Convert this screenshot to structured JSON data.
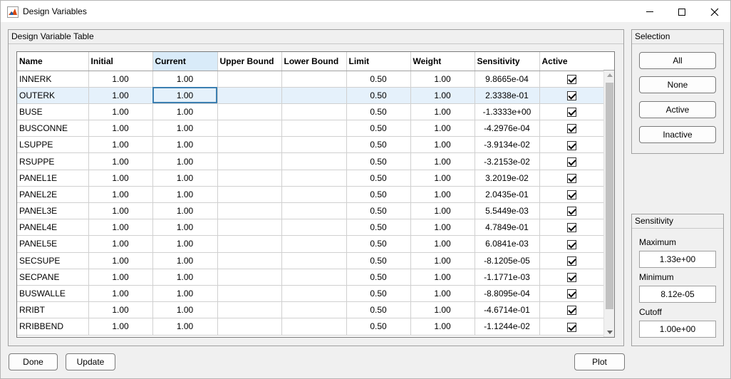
{
  "window": {
    "title": "Design Variables"
  },
  "table_panel": {
    "title": "Design Variable Table"
  },
  "table": {
    "headers": [
      "Name",
      "Initial",
      "Current",
      "Upper Bound",
      "Lower Bound",
      "Limit",
      "Weight",
      "Sensitivity",
      "Active"
    ],
    "rows": [
      {
        "name": "INNERK",
        "initial": "1.00",
        "current": "1.00",
        "upper": "",
        "lower": "",
        "limit": "0.50",
        "weight": "1.00",
        "sensitivity": "9.8665e-04",
        "active": true
      },
      {
        "name": "OUTERK",
        "initial": "1.00",
        "current": "1.00",
        "upper": "",
        "lower": "",
        "limit": "0.50",
        "weight": "1.00",
        "sensitivity": "2.3338e-01",
        "active": true
      },
      {
        "name": "BUSE",
        "initial": "1.00",
        "current": "1.00",
        "upper": "",
        "lower": "",
        "limit": "0.50",
        "weight": "1.00",
        "sensitivity": "-1.3333e+00",
        "active": true
      },
      {
        "name": "BUSCONNE",
        "initial": "1.00",
        "current": "1.00",
        "upper": "",
        "lower": "",
        "limit": "0.50",
        "weight": "1.00",
        "sensitivity": "-4.2976e-04",
        "active": true
      },
      {
        "name": "LSUPPE",
        "initial": "1.00",
        "current": "1.00",
        "upper": "",
        "lower": "",
        "limit": "0.50",
        "weight": "1.00",
        "sensitivity": "-3.9134e-02",
        "active": true
      },
      {
        "name": "RSUPPE",
        "initial": "1.00",
        "current": "1.00",
        "upper": "",
        "lower": "",
        "limit": "0.50",
        "weight": "1.00",
        "sensitivity": "-3.2153e-02",
        "active": true
      },
      {
        "name": "PANEL1E",
        "initial": "1.00",
        "current": "1.00",
        "upper": "",
        "lower": "",
        "limit": "0.50",
        "weight": "1.00",
        "sensitivity": "3.2019e-02",
        "active": true
      },
      {
        "name": "PANEL2E",
        "initial": "1.00",
        "current": "1.00",
        "upper": "",
        "lower": "",
        "limit": "0.50",
        "weight": "1.00",
        "sensitivity": "2.0435e-01",
        "active": true
      },
      {
        "name": "PANEL3E",
        "initial": "1.00",
        "current": "1.00",
        "upper": "",
        "lower": "",
        "limit": "0.50",
        "weight": "1.00",
        "sensitivity": "5.5449e-03",
        "active": true
      },
      {
        "name": "PANEL4E",
        "initial": "1.00",
        "current": "1.00",
        "upper": "",
        "lower": "",
        "limit": "0.50",
        "weight": "1.00",
        "sensitivity": "4.7849e-01",
        "active": true
      },
      {
        "name": "PANEL5E",
        "initial": "1.00",
        "current": "1.00",
        "upper": "",
        "lower": "",
        "limit": "0.50",
        "weight": "1.00",
        "sensitivity": "6.0841e-03",
        "active": true
      },
      {
        "name": "SECSUPE",
        "initial": "1.00",
        "current": "1.00",
        "upper": "",
        "lower": "",
        "limit": "0.50",
        "weight": "1.00",
        "sensitivity": "-8.1205e-05",
        "active": true
      },
      {
        "name": "SECPANE",
        "initial": "1.00",
        "current": "1.00",
        "upper": "",
        "lower": "",
        "limit": "0.50",
        "weight": "1.00",
        "sensitivity": "-1.1771e-03",
        "active": true
      },
      {
        "name": "BUSWALLE",
        "initial": "1.00",
        "current": "1.00",
        "upper": "",
        "lower": "",
        "limit": "0.50",
        "weight": "1.00",
        "sensitivity": "-8.8095e-04",
        "active": true
      },
      {
        "name": "RRIBT",
        "initial": "1.00",
        "current": "1.00",
        "upper": "",
        "lower": "",
        "limit": "0.50",
        "weight": "1.00",
        "sensitivity": "-4.6714e-01",
        "active": true
      },
      {
        "name": "RRIBBEND",
        "initial": "1.00",
        "current": "1.00",
        "upper": "",
        "lower": "",
        "limit": "0.50",
        "weight": "1.00",
        "sensitivity": "-1.1244e-02",
        "active": true
      }
    ]
  },
  "selection_panel": {
    "title": "Selection",
    "buttons": [
      "All",
      "None",
      "Active",
      "Inactive"
    ]
  },
  "sensitivity_panel": {
    "title": "Sensitivity",
    "max_label": "Maximum",
    "max_value": "1.33e+00",
    "min_label": "Minimum",
    "min_value": "8.12e-05",
    "cutoff_label": "Cutoff",
    "cutoff_value": "1.00e+00"
  },
  "footer": {
    "done": "Done",
    "update": "Update",
    "plot": "Plot"
  },
  "colors": {
    "selected_header": "#d9ebf9",
    "highlight_row": "#e5f1fb",
    "matlab_icon": "#d9480f"
  }
}
